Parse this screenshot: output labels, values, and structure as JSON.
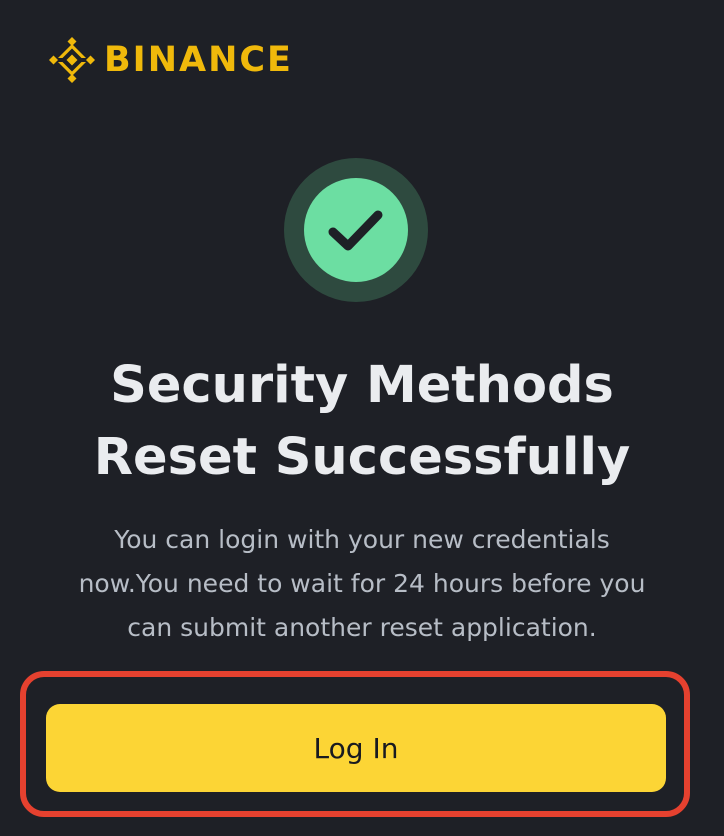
{
  "brand": {
    "name": "BINANCE",
    "logo_icon": "binance-diamond-icon",
    "color": "#f0b90b"
  },
  "status": {
    "icon": "check-circle-icon",
    "circle_color": "#6cdea2",
    "ring_color": "#2e4a3f",
    "check_color": "#1e2026"
  },
  "heading": {
    "line1": "Security Methods",
    "line2": "Reset Successfully"
  },
  "message": {
    "line1": "You can login with your new credentials",
    "line2": "now.You need to wait for 24 hours before you",
    "line3": "can submit another reset application."
  },
  "actions": {
    "login_label": "Log In",
    "login_color": "#fcd535",
    "highlight_color": "#e5412f"
  },
  "colors": {
    "background": "#1e2026",
    "heading_text": "#eaecef",
    "body_text": "#b7bdc6"
  }
}
